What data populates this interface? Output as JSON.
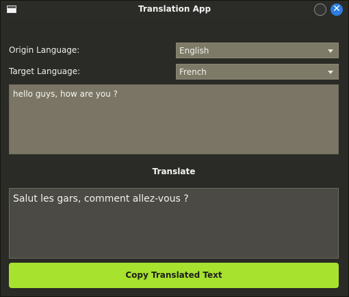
{
  "window": {
    "title": "Translation App"
  },
  "titlebar": {
    "close_glyph": "✕"
  },
  "form": {
    "origin_label": "Origin Language:",
    "origin_value": "English",
    "target_label": "Target Language:",
    "target_value": "French"
  },
  "input": {
    "text": "hello guys, how are you ?"
  },
  "actions": {
    "translate_label": "Translate",
    "copy_label": "Copy Translated Text"
  },
  "output": {
    "text": "Salut les gars, comment allez-vous ?"
  },
  "colors": {
    "accent_green": "#a6e22e",
    "close_blue": "#2b7de0",
    "background": "#2a2a26",
    "input_bg": "#7a7564",
    "output_bg": "#4b4a44",
    "select_bg": "#7d7a68"
  }
}
